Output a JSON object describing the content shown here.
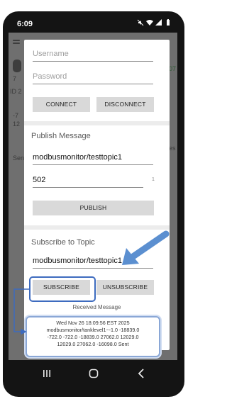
{
  "status_bar": {
    "time": "6:09",
    "icons": [
      "mute-icon",
      "wifi-icon",
      "signal-icon",
      "battery-icon"
    ]
  },
  "dialog": {
    "username_placeholder": "Username",
    "password_placeholder": "Password",
    "connect_label": "CONNECT",
    "disconnect_label": "DISCONNECT",
    "publish_heading": "Publish Message",
    "publish_topic": "modbusmonitor/testtopic1",
    "publish_value": "502",
    "publish_counter": "1",
    "publish_label": "PUBLISH",
    "subscribe_heading": "Subscribe to Topic",
    "subscribe_topic": "modbusmonitor/testtopic1",
    "subscribe_label": "SUBSCRIBE",
    "unsubscribe_label": "UNSUBSCRIBE",
    "received_heading": "Received Message",
    "received_lines": [
      "Wed Nov 26 18:09:56 EST 2025",
      "modbusmonitor/tanklevel1~-1.0  -18839.0",
      "-722.0  -722.0  -18839.0  27062.0  12029.0",
      "12029.0  27062.0  -16098.0  Sent"
    ]
  },
  "background": {
    "hints": [
      "7",
      "07",
      "ID 2",
      "-7",
      "12",
      "es",
      "Sen"
    ]
  },
  "navigation": {
    "items": [
      "recents-icon",
      "home-icon",
      "back-icon"
    ]
  },
  "colors": {
    "phone_frame": "#141414",
    "dim_overlay": "#6f6f6f",
    "button_gray": "#d9d9d9",
    "annotation_blue": "#3d6bbf",
    "arrow_blue": "#5b8fd0"
  }
}
